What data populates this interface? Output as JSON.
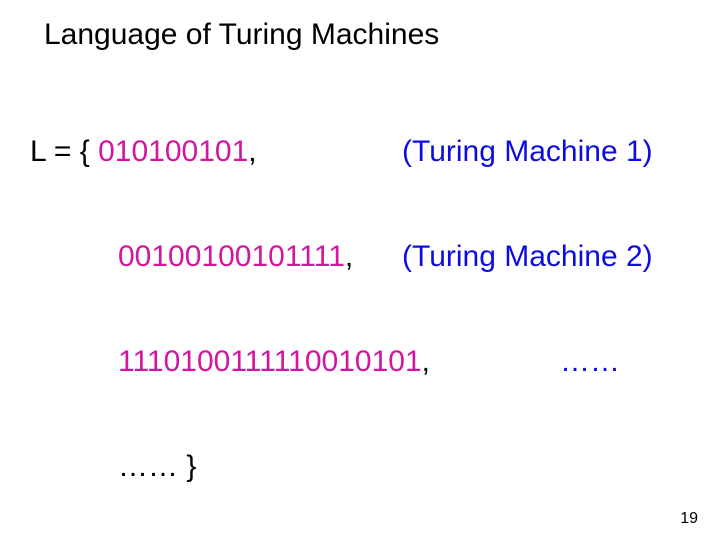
{
  "title": "Language of Turing Machines",
  "prefix": "L = { ",
  "rows": [
    {
      "binary": "010100101",
      "punct": ",",
      "annotation": "(Turing Machine 1)"
    },
    {
      "binary": "00100100101111",
      "punct": ",",
      "annotation": "(Turing Machine 2)"
    },
    {
      "binary": "1110100111110010101",
      "punct": ",",
      "annotation": "……"
    }
  ],
  "closing": "…… }",
  "page_number": "19"
}
